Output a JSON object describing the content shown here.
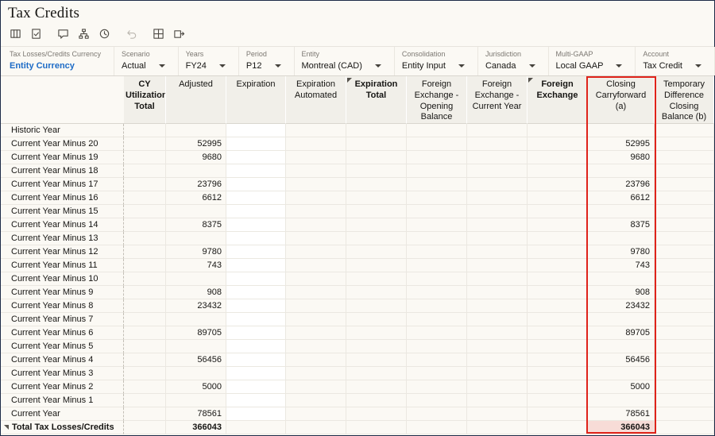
{
  "title": "Tax Credits",
  "toolbar": {
    "buttons": [
      "pov-settings",
      "actions",
      "comments",
      "supporting-detail",
      "history",
      "undo",
      "freeze-grid",
      "export"
    ]
  },
  "pov": {
    "items": [
      {
        "label": "Tax Losses/Credits Currency",
        "value": "Entity Currency",
        "link": true
      },
      {
        "label": "Scenario",
        "value": "Actual"
      },
      {
        "label": "Years",
        "value": "FY24"
      },
      {
        "label": "Period",
        "value": "P12"
      },
      {
        "label": "Entity",
        "value": "Montreal (CAD)"
      },
      {
        "label": "Consolidation",
        "value": "Entity Input"
      },
      {
        "label": "Jurisdiction",
        "value": "Canada"
      },
      {
        "label": "Multi-GAAP",
        "value": "Local GAAP"
      },
      {
        "label": "Account",
        "value": "Tax Credit"
      }
    ]
  },
  "grid": {
    "columns": [
      {
        "key": "cy_utilization_total",
        "label": "CY Utilization Total",
        "bold": true
      },
      {
        "key": "adjusted",
        "label": "Adjusted"
      },
      {
        "key": "expiration",
        "label": "Expiration",
        "editable": true
      },
      {
        "key": "expiration_automated",
        "label": "Expiration Automated"
      },
      {
        "key": "expiration_total",
        "label": "Expiration Total",
        "bold": true,
        "marker": true
      },
      {
        "key": "fx_opening_balance",
        "label": "Foreign Exchange - Opening Balance"
      },
      {
        "key": "fx_current_year",
        "label": "Foreign Exchange - Current Year"
      },
      {
        "key": "foreign_exchange",
        "label": "Foreign Exchange",
        "bold": true,
        "marker": true
      },
      {
        "key": "closing_carryforward",
        "label": "Closing Carryforward (a)",
        "highlighted": true
      },
      {
        "key": "temporary_difference_closing_balance",
        "label": "Temporary Difference Closing Balance (b)"
      }
    ],
    "rows": [
      {
        "label": "Historic Year",
        "values": {}
      },
      {
        "label": "Current Year Minus 20",
        "values": {
          "adjusted": "52995",
          "closing_carryforward": "52995"
        }
      },
      {
        "label": "Current Year Minus 19",
        "values": {
          "adjusted": "9680",
          "closing_carryforward": "9680"
        }
      },
      {
        "label": "Current Year Minus 18",
        "values": {}
      },
      {
        "label": "Current Year Minus 17",
        "values": {
          "adjusted": "23796",
          "closing_carryforward": "23796"
        }
      },
      {
        "label": "Current Year Minus 16",
        "values": {
          "adjusted": "6612",
          "closing_carryforward": "6612"
        }
      },
      {
        "label": "Current Year Minus 15",
        "values": {}
      },
      {
        "label": "Current Year Minus 14",
        "values": {
          "adjusted": "8375",
          "closing_carryforward": "8375"
        }
      },
      {
        "label": "Current Year Minus 13",
        "values": {}
      },
      {
        "label": "Current Year Minus 12",
        "values": {
          "adjusted": "9780",
          "closing_carryforward": "9780"
        }
      },
      {
        "label": "Current Year Minus 11",
        "values": {
          "adjusted": "743",
          "closing_carryforward": "743"
        }
      },
      {
        "label": "Current Year Minus 10",
        "values": {}
      },
      {
        "label": "Current Year Minus 9",
        "values": {
          "adjusted": "908",
          "closing_carryforward": "908"
        }
      },
      {
        "label": "Current Year Minus 8",
        "values": {
          "adjusted": "23432",
          "closing_carryforward": "23432"
        }
      },
      {
        "label": "Current Year Minus 7",
        "values": {}
      },
      {
        "label": "Current Year Minus 6",
        "values": {
          "adjusted": "89705",
          "closing_carryforward": "89705"
        }
      },
      {
        "label": "Current Year Minus 5",
        "values": {}
      },
      {
        "label": "Current Year Minus 4",
        "values": {
          "adjusted": "56456",
          "closing_carryforward": "56456"
        }
      },
      {
        "label": "Current Year Minus 3",
        "values": {}
      },
      {
        "label": "Current Year Minus 2",
        "values": {
          "adjusted": "5000",
          "closing_carryforward": "5000"
        }
      },
      {
        "label": "Current Year Minus 1",
        "values": {}
      },
      {
        "label": "Current Year",
        "values": {
          "adjusted": "78561",
          "closing_carryforward": "78561"
        }
      },
      {
        "label": "Total Tax Losses/Credits",
        "total": true,
        "values": {
          "adjusted": "366043",
          "closing_carryforward": "366043"
        }
      }
    ]
  },
  "colors": {
    "selection_red": "#df231a",
    "total_highlight": "#f7dcd7",
    "link_blue": "#1c6bc6",
    "header_bg": "#f1efe9",
    "page_bg": "#fbf9f4"
  }
}
